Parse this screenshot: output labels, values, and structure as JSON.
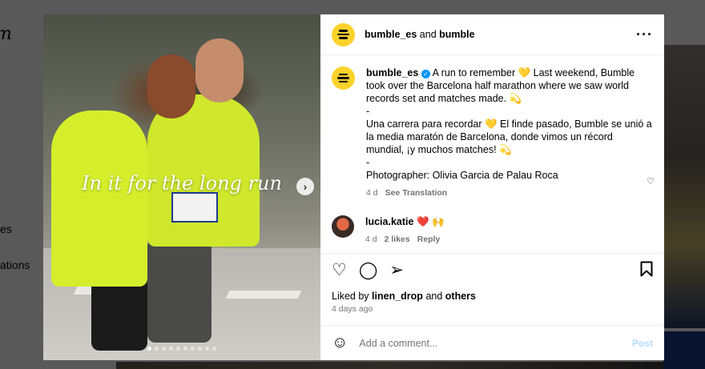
{
  "background": {
    "logo_fragment": "m",
    "nav_fragments": [
      "es",
      "ations"
    ]
  },
  "media": {
    "caption": "In it for the long run",
    "next_icon": "chevron-right-icon",
    "carousel": {
      "count": 10,
      "active_index": 0
    }
  },
  "header": {
    "account": "bumble_es",
    "connector": "and",
    "collaborator": "bumble",
    "more_icon": "more-horizontal-icon"
  },
  "post": {
    "username": "bumble_es",
    "verified": true,
    "lines": [
      "A run to remember 💛 Last weekend, Bumble took over the Barcelona half marathon where we saw world records set and matches made. 💫",
      "-",
      "Una carrera para recordar 💛 El finde pasado, Bumble se unió a la media maratón de Barcelona, donde vimos un récord mundial, ¡y muchos matches! 💫",
      "-",
      "Photographer: Olivia Garcia de Palau Roca"
    ],
    "time": "4 d",
    "see_translation": "See Translation"
  },
  "comment": {
    "username": "lucia.katie",
    "text": "❤️ 🙌",
    "time": "4 d",
    "likes": "2 likes",
    "reply": "Reply"
  },
  "actions": {
    "liked_by_prefix": "Liked by",
    "liked_by_user": "linen_drop",
    "liked_by_and": "and",
    "liked_by_others": "others",
    "time_ago": "4 days ago"
  },
  "add_comment": {
    "placeholder": "Add a comment...",
    "post_label": "Post"
  },
  "colors": {
    "bumble_yellow": "#fdd22a",
    "verified_blue": "#0095f6",
    "post_disabled": "#b3dbff"
  }
}
